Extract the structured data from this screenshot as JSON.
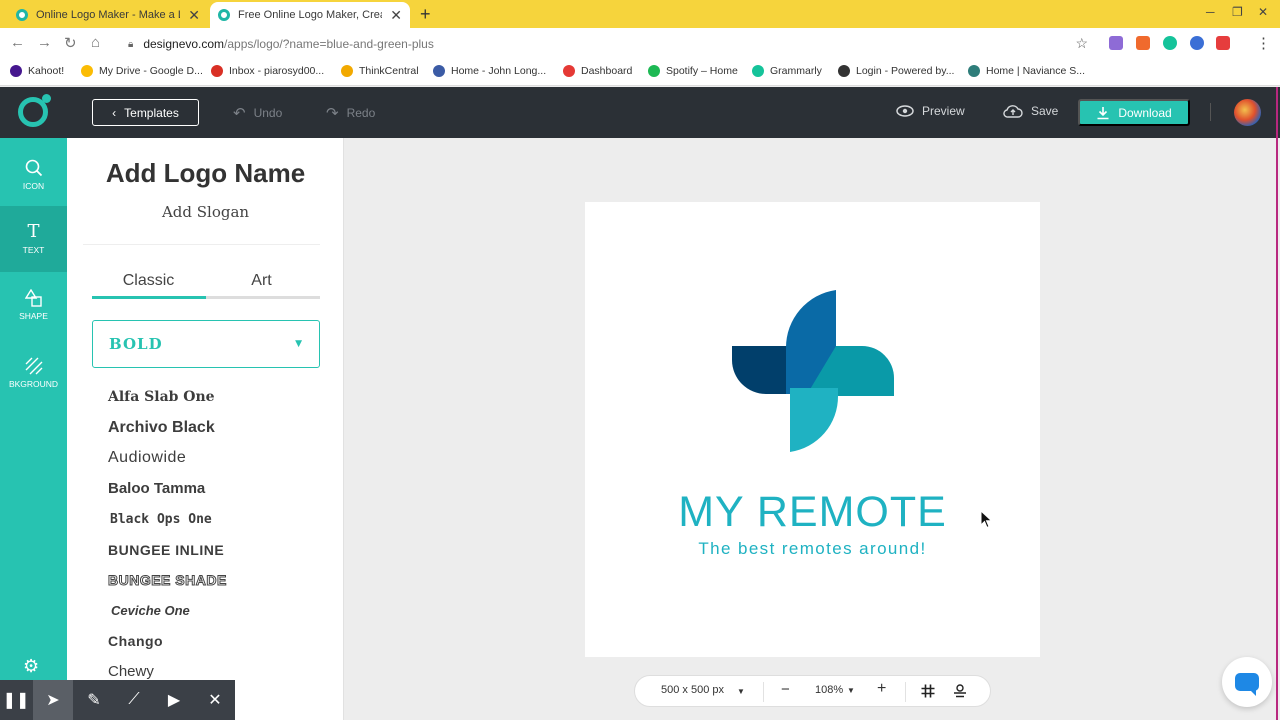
{
  "browser": {
    "tabs": [
      {
        "title": "Online Logo Maker - Make a Log"
      },
      {
        "title": "Free Online Logo Maker, Create C"
      }
    ],
    "new_tab": "+",
    "url_host": "designevo.com",
    "url_path": "/apps/logo/?name=blue-and-green-plus",
    "bookmarks": [
      {
        "label": "Kahoot!",
        "color": "#46178f"
      },
      {
        "label": "My Drive - Google D...",
        "color": "#fbbc04"
      },
      {
        "label": "Inbox - piarosyd00...",
        "color": "#d93025"
      },
      {
        "label": "ThinkCentral",
        "color": "#f2a900"
      },
      {
        "label": "Home - John Long...",
        "color": "#3b5ba5"
      },
      {
        "label": "Dashboard",
        "color": "#e53935"
      },
      {
        "label": "Spotify – Home",
        "color": "#1db954"
      },
      {
        "label": "Grammarly",
        "color": "#15c39a"
      },
      {
        "label": "Login - Powered by...",
        "color": "#333333"
      },
      {
        "label": "Home | Naviance S...",
        "color": "#2e7d7a"
      }
    ]
  },
  "toolbar": {
    "templates_label": "Templates",
    "undo_label": "Undo",
    "redo_label": "Redo",
    "preview_label": "Preview",
    "save_label": "Save",
    "download_label": "Download"
  },
  "sidebar": {
    "items": [
      {
        "label": "ICON",
        "icon": "search-icon"
      },
      {
        "label": "TEXT",
        "icon": "text-icon"
      },
      {
        "label": "SHAPE",
        "icon": "shape-icon"
      },
      {
        "label": "BKGROUND",
        "icon": "background-icon"
      }
    ]
  },
  "panel": {
    "title": "Add Logo Name",
    "slogan": "Add Slogan",
    "tabs": [
      "Classic",
      "Art"
    ],
    "font_category": "Bold",
    "fonts": [
      "Alfa Slab One",
      "Archivo Black",
      "Audiowide",
      "Baloo Tamma",
      "Black Ops One",
      "BUNGEE INLINE",
      "BUNGEE SHADE",
      "Ceviche One",
      "Chango",
      "Chewy"
    ]
  },
  "canvas": {
    "brand_name": "MY REMOTE",
    "tagline": "The best remotes around!",
    "size": "500 x 500 px",
    "zoom": "108%",
    "accent_color": "#27c3b1",
    "logo_colors": [
      "#013f6b",
      "#0a6aa6",
      "#0a9aa8",
      "#1fb2c2"
    ]
  }
}
